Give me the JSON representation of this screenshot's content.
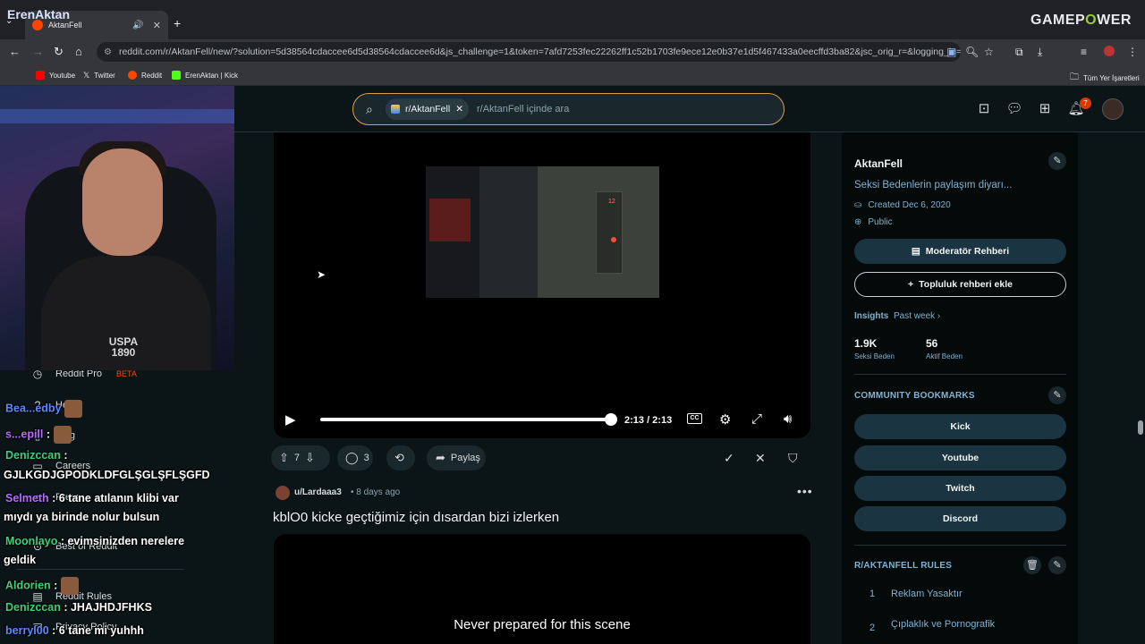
{
  "browser": {
    "tab_title": "AktanFell",
    "newtab_glyph": "+",
    "address": "reddit.com/r/AktanFell/new/?solution=5d38564cdaccee6d5d38564cdaccee6d&js_challenge=1&token=7afd7253fec22262ff1c52b1703fe9ece12e0b37e1d5f467433a0eecffd3ba82&jsc_orig_r=&logging_in=true&scre...",
    "bookmarks": [
      {
        "label": "Youtube",
        "color": "#ff0000"
      },
      {
        "label": "Twitter",
        "color": "#ffffff"
      },
      {
        "label": "Reddit",
        "color": "#ff4500"
      },
      {
        "label": "ErenAktan | Kick",
        "color": "#53fc18"
      }
    ],
    "all_bookmarks": "Tüm Yer İşaretleri",
    "brand_overlay": {
      "part1": "GAMEP",
      "part2": "O",
      "part3": "WER"
    }
  },
  "header": {
    "search_chip": "r/AktanFell",
    "search_placeholder": "r/AktanFell içinde ara",
    "notifications_count": "7"
  },
  "post1": {
    "time": "2:13 / 2:13",
    "cc_label": "CC",
    "progress_fraction": 1.0,
    "upvotes": "7",
    "comments": "3",
    "share_label": "Paylaş"
  },
  "post2": {
    "author": "u/Lardaaa3",
    "meta": "• 8 days ago",
    "title": "kblO0 kicke geçtiğimiz için dısardan bizi izlerken",
    "video_caption": "Never prepared for this scene"
  },
  "sidebar": {
    "name": "AktanFell",
    "description": "Seksi Bedenlerin paylaşım diyarı...",
    "created": "Created Dec 6, 2020",
    "visibility": "Public",
    "mod_guide_btn": "Moderatör Rehberi",
    "add_guide_btn": "Topluluk rehberi ekle",
    "insights_label": "Insights",
    "insights_period": "Past week",
    "stats": [
      {
        "value": "1.9K",
        "label": "Seksi Beden"
      },
      {
        "value": "56",
        "label": "Aktif Beden"
      }
    ],
    "bookmarks_title": "COMMUNITY BOOKMARKS",
    "bookmarks": [
      "Kick",
      "Youtube",
      "Twitch",
      "Discord"
    ],
    "rules_title": "R/AKTANFELL RULES",
    "rules": [
      {
        "num": "1",
        "text": "Reklam Yasaktır"
      },
      {
        "num": "2",
        "text": "Çıplaklık ve Pornografik"
      }
    ]
  },
  "overlay": {
    "stream_logo": "ErenAktan",
    "shirt_text": "USPA 1890",
    "nav": [
      {
        "label": "Reddit Pro",
        "badge": "BETA"
      },
      {
        "label": "Help"
      },
      {
        "label": "Blog"
      },
      {
        "label": "Careers"
      },
      {
        "label": "Press"
      },
      {
        "label": "Best of Reddit"
      },
      {
        "label": "Reddit Rules"
      },
      {
        "label": "Privacy Policy"
      }
    ],
    "chat": [
      {
        "user": "Bea...edby",
        "text": "",
        "color": "#5b8cff"
      },
      {
        "user": "s...epill",
        "text": " :",
        "color": "#b56cff"
      },
      {
        "user": "Denizccan",
        "text": " :",
        "color": "#3fd07a"
      },
      {
        "user": "",
        "text": "GJLKGDJGPODKLDFGLŞGLŞFLŞGFD",
        "color": "#ffffff"
      },
      {
        "user": "Selmeth",
        "text": " : 6 tane atılanın klibi var",
        "color": "#b56cff"
      },
      {
        "user": "",
        "text": "mıydı ya birinde nolur bulsun",
        "color": "#ffffff"
      },
      {
        "user": "Moonlayo",
        "text": " : evimsinizden nerelere",
        "color": "#3fd07a"
      },
      {
        "user": "",
        "text": "geldik",
        "color": "#ffffff"
      },
      {
        "user": "Aldorien",
        "text": " :",
        "color": "#3fd07a"
      },
      {
        "user": "Denizccan",
        "text": " : JHAJHDJFHKS",
        "color": "#3fd07a"
      },
      {
        "user": "berryl00",
        "text": " : 6 tane mi yuhhh",
        "color": "#5b8cff"
      }
    ]
  }
}
